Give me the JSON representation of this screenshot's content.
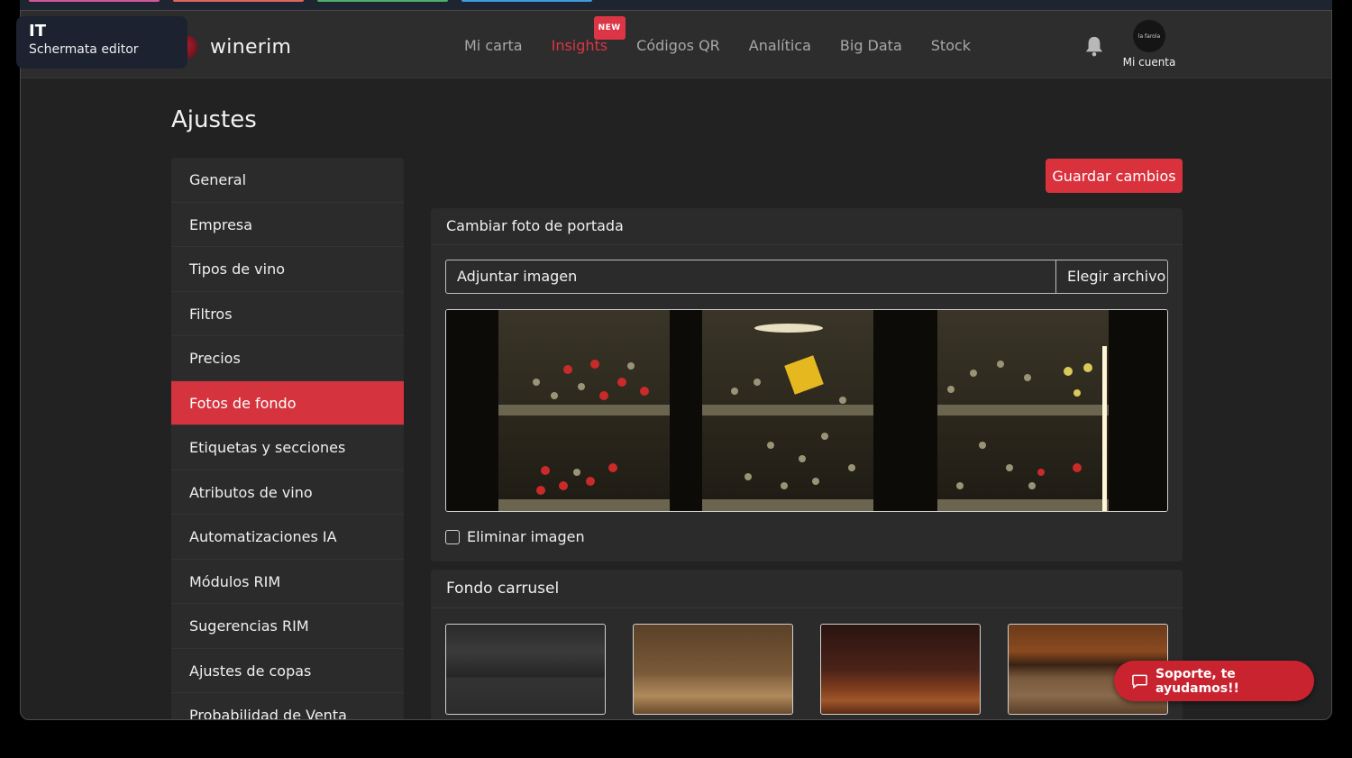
{
  "overlay": {
    "code": "IT",
    "subtitle": "Schermata editor"
  },
  "brand": {
    "name": "winerim"
  },
  "nav": {
    "items": [
      {
        "label": "Mi carta"
      },
      {
        "label": "Insights",
        "badge": "NEW"
      },
      {
        "label": "Códigos QR"
      },
      {
        "label": "Analítica"
      },
      {
        "label": "Big Data"
      },
      {
        "label": "Stock"
      }
    ],
    "account_label": "Mi cuenta",
    "avatar_text": "la farola"
  },
  "page": {
    "title": "Ajustes"
  },
  "sidebar": {
    "items": [
      {
        "label": "General"
      },
      {
        "label": "Empresa"
      },
      {
        "label": "Tipos de vino"
      },
      {
        "label": "Filtros"
      },
      {
        "label": "Precios"
      },
      {
        "label": "Fotos de fondo"
      },
      {
        "label": "Etiquetas y secciones"
      },
      {
        "label": "Atributos de vino"
      },
      {
        "label": "Automatizaciones IA"
      },
      {
        "label": "Módulos RIM"
      },
      {
        "label": "Sugerencias RIM"
      },
      {
        "label": "Ajustes de copas"
      },
      {
        "label": "Probabilidad de Venta"
      }
    ]
  },
  "toolbar": {
    "save_label": "Guardar cambios"
  },
  "cover": {
    "header": "Cambiar foto de portada",
    "upload_placeholder": "Adjuntar imagen",
    "upload_button": "Elegir archivo",
    "remove_label": "Eliminar imagen"
  },
  "carousel": {
    "header": "Fondo carrusel"
  },
  "support": {
    "label": "Soporte, te ayudamos!!"
  },
  "colors": {
    "accent": "#dc3545",
    "background": "#222222",
    "card": "#2b2b2b"
  }
}
